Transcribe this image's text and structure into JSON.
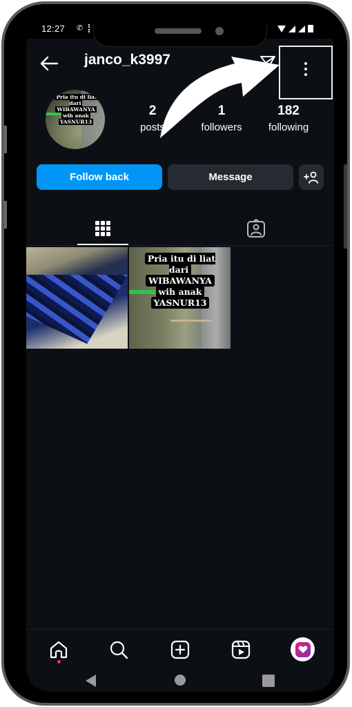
{
  "status_bar": {
    "time": "12:27",
    "icons": [
      "call-icon",
      "data-dots-icon",
      "wifi-icon",
      "signal-icon",
      "signal-icon",
      "battery-icon"
    ]
  },
  "header": {
    "back_icon": "arrow-left-icon",
    "username": "janco_k3997",
    "direct_icon": "paper-plane-icon",
    "more_icon": "vertical-dots-icon"
  },
  "profile": {
    "avatar_caption": [
      "Pria itu di liat dari",
      "WIBAWANYA",
      "wih anak",
      "YASNUR13"
    ],
    "stats": [
      {
        "value": "2",
        "label": "posts"
      },
      {
        "value": "1",
        "label": "followers"
      },
      {
        "value": "182",
        "label": "following"
      }
    ]
  },
  "actions": {
    "follow_back": "Follow back",
    "message": "Message",
    "add_user_icon": "add-person-icon"
  },
  "tabs": [
    {
      "name": "posts-grid",
      "icon": "grid-icon",
      "active": true
    },
    {
      "name": "tagged",
      "icon": "tagged-person-icon",
      "active": false
    }
  ],
  "posts": [
    {
      "caption": null
    },
    {
      "caption": [
        "Pria itu di liat dari",
        "WIBAWANYA",
        "wih anak",
        "YASNUR13"
      ]
    }
  ],
  "bottom_nav": [
    {
      "name": "home",
      "icon": "home-icon",
      "notification_dot": true
    },
    {
      "name": "search",
      "icon": "search-icon"
    },
    {
      "name": "create",
      "icon": "plus-square-icon"
    },
    {
      "name": "reels",
      "icon": "reels-icon"
    },
    {
      "name": "profile",
      "icon": "profile-avatar-icon"
    }
  ],
  "colors": {
    "accent": "#0095f6",
    "background": "#0c0f14",
    "button_secondary": "#262a31",
    "notification_dot": "#ff3040"
  },
  "annotation": {
    "type": "curved-arrow",
    "points_to": "more-options-button"
  }
}
